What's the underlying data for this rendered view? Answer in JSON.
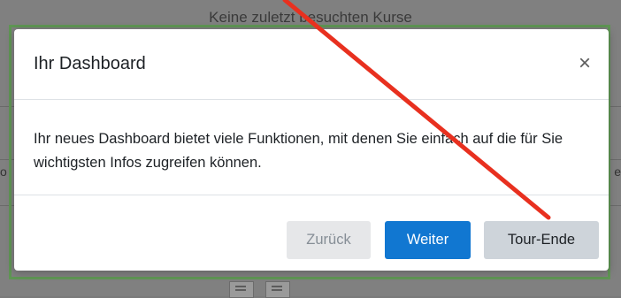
{
  "background": {
    "heading": "Keine zuletzt besuchten Kurse",
    "edge_left": "o",
    "edge_right": "e"
  },
  "modal": {
    "title": "Ihr Dashboard",
    "close_symbol": "×",
    "body": "Ihr neues Dashboard bietet viele Funktionen, mit denen Sie einfach auf die für Sie wichtigsten Infos zugreifen können.",
    "buttons": {
      "back": "Zurück",
      "next": "Weiter",
      "end": "Tour-Ende"
    }
  },
  "colors": {
    "primary": "#1177d1",
    "frame_highlight": "#5f9654",
    "annotation_arrow": "#e8301f"
  }
}
